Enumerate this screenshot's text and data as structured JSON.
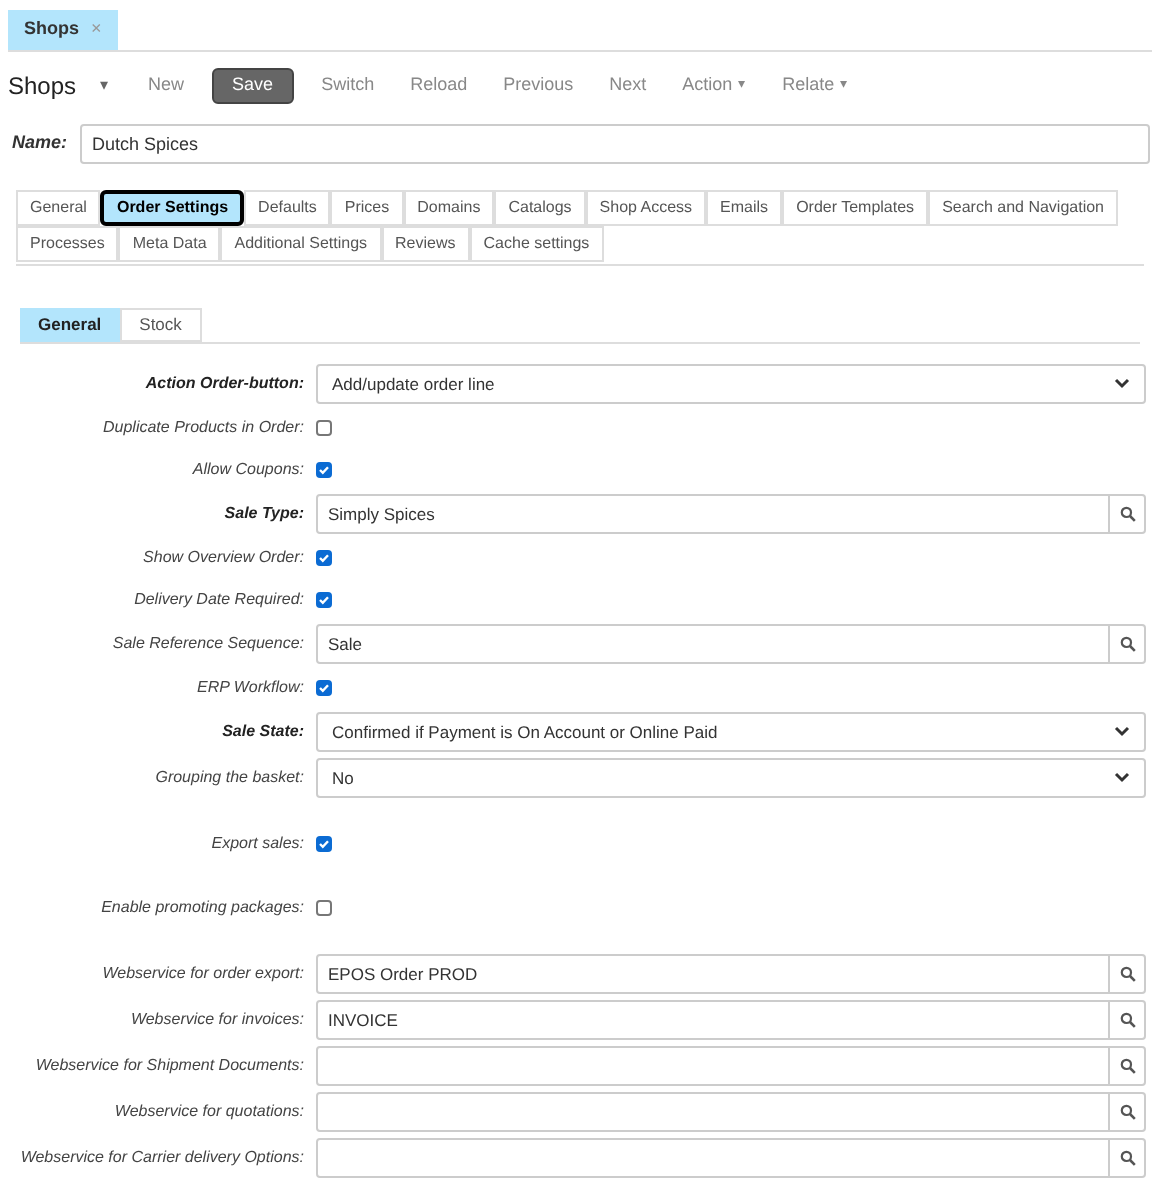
{
  "doc_tabs": [
    {
      "label": "Shops",
      "close": "×",
      "selected": true
    }
  ],
  "toolbar": {
    "title": "Shops",
    "title_caret": "▾",
    "buttons": [
      {
        "label": "New",
        "kind": "plain"
      },
      {
        "label": "Save",
        "kind": "primary"
      },
      {
        "label": "Switch",
        "kind": "plain"
      },
      {
        "label": "Reload",
        "kind": "plain"
      },
      {
        "label": "Previous",
        "kind": "plain"
      },
      {
        "label": "Next",
        "kind": "plain"
      },
      {
        "label": "Action",
        "kind": "menu",
        "caret": "▾"
      },
      {
        "label": "Relate",
        "kind": "menu",
        "caret": "▾"
      }
    ]
  },
  "name_field": {
    "label": "Name:",
    "value": "Dutch Spices"
  },
  "tabs": [
    [
      {
        "label": "General",
        "selected": false
      },
      {
        "label": "Order Settings",
        "selected": true
      },
      {
        "label": "Defaults",
        "selected": false
      },
      {
        "label": "Prices",
        "selected": false
      },
      {
        "label": "Domains",
        "selected": false
      },
      {
        "label": "Catalogs",
        "selected": false
      },
      {
        "label": "Shop Access",
        "selected": false
      },
      {
        "label": "Emails",
        "selected": false
      },
      {
        "label": "Order Templates",
        "selected": false
      },
      {
        "label": "Search and Navigation",
        "selected": false
      }
    ],
    [
      {
        "label": "Processes",
        "selected": false
      },
      {
        "label": "Meta Data",
        "selected": false
      },
      {
        "label": "Additional Settings",
        "selected": false
      },
      {
        "label": "Reviews",
        "selected": false
      },
      {
        "label": "Cache settings",
        "selected": false
      }
    ]
  ],
  "sub_tabs": [
    {
      "label": "General",
      "selected": true
    },
    {
      "label": "Stock",
      "selected": false
    }
  ],
  "field_groups": [
    [
      {
        "label": "Action Order-button:",
        "required": true,
        "kind": "select",
        "value": "Add/update order line"
      },
      {
        "label": "Duplicate Products in Order:",
        "required": false,
        "kind": "checkbox",
        "checked": false
      },
      {
        "label": "Allow Coupons:",
        "required": false,
        "kind": "checkbox",
        "checked": true
      },
      {
        "label": "Sale Type:",
        "required": true,
        "kind": "lookup",
        "value": "Simply Spices"
      },
      {
        "label": "Show Overview Order:",
        "required": false,
        "kind": "checkbox",
        "checked": true
      },
      {
        "label": "Delivery Date Required:",
        "required": false,
        "kind": "checkbox",
        "checked": true
      },
      {
        "label": "Sale Reference Sequence:",
        "required": false,
        "kind": "lookup",
        "value": "Sale"
      },
      {
        "label": "ERP Workflow:",
        "required": false,
        "kind": "checkbox",
        "checked": true
      },
      {
        "label": "Sale State:",
        "required": true,
        "kind": "select",
        "value": "Confirmed if Payment is On Account or Online Paid"
      },
      {
        "label": "Grouping the basket:",
        "required": false,
        "kind": "select",
        "value": "No"
      }
    ],
    [
      {
        "label": "Export sales:",
        "required": false,
        "kind": "checkbox",
        "checked": true
      }
    ],
    [
      {
        "label": "Enable promoting packages:",
        "required": false,
        "kind": "checkbox",
        "checked": false
      }
    ],
    [
      {
        "label": "Webservice for order export:",
        "required": false,
        "kind": "lookup",
        "value": "EPOS Order PROD"
      },
      {
        "label": "Webservice for invoices:",
        "required": false,
        "kind": "lookup",
        "value": "INVOICE"
      },
      {
        "label": "Webservice for Shipment Documents:",
        "required": false,
        "kind": "lookup"
      },
      {
        "label": "Webservice for quotations:",
        "required": false,
        "kind": "lookup"
      },
      {
        "label": "Webservice for Carrier delivery Options:",
        "required": false,
        "kind": "lookup"
      }
    ]
  ]
}
